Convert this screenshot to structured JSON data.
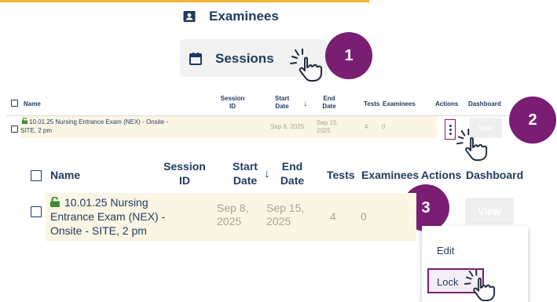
{
  "nav": {
    "examinees_label": "Examinees",
    "sessions_label": "Sessions",
    "examinees_icon": "id-badge-icon",
    "sessions_icon": "calendar-icon"
  },
  "steps": [
    "1",
    "2",
    "3"
  ],
  "table": {
    "columns": {
      "name": "Name",
      "session_id": "Session ID",
      "start_date": "Start Date",
      "end_date": "End Date",
      "tests": "Tests",
      "examinees": "Examinees",
      "actions": "Actions",
      "dashboard": "Dashboard"
    },
    "small_columns": {
      "session_id_1": "Session",
      "session_id_2": "ID",
      "start_1": "Start",
      "start_2": "Date",
      "end_1": "End",
      "end_2": "Date"
    },
    "large_columns": {
      "session_id_1": "Session",
      "session_id_2": "ID",
      "start_1": "Start",
      "start_2": "Date",
      "end_1": "End",
      "end_2": "Date"
    },
    "row": {
      "name": "10.01.25 Nursing Entrance Exam (NEX) - Onsite - SITE, 2 pm",
      "name_small_1": "10.01.25 Nursing Entrance Exam (NEX) - Onsite -",
      "name_small_2": "SITE, 2 pm",
      "name_large_1": "10.01.25 Nursing",
      "name_large_2": "Entrance Exam (NEX) -",
      "name_large_3": "Onsite - SITE, 2 pm",
      "start_date": "Sep 8, 2025",
      "end_date_small_1": "Sep 15,",
      "end_date_small_2": "2025",
      "start_large_1": "Sep 8,",
      "start_large_2": "2025",
      "end_large_1": "Sep 15,",
      "end_large_2": "2025",
      "tests": "4",
      "examinees": "0",
      "view_label": "View"
    },
    "sort_arrow": "↓"
  },
  "menu": {
    "edit_label": "Edit",
    "lock_label": "Lock"
  },
  "colors": {
    "accent": "#7a1e73",
    "text": "#1f3a5f",
    "row_highlight": "#fbf6e4",
    "top_bar": "#f5b335"
  }
}
